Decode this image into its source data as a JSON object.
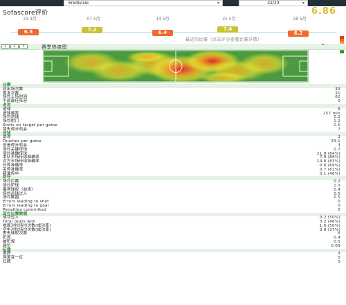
{
  "header": {
    "league": "Eredivisie",
    "season": "22/23",
    "rating_title": "Sofascore评价",
    "average_rating": "6.86"
  },
  "timeline": {
    "dates": [
      "23 4月",
      "07 5月",
      "14 5月",
      "21 5月",
      "28 5月"
    ],
    "ratings": [
      {
        "value": "6.5",
        "color": "#f06a2c"
      },
      {
        "value": "7.2",
        "color": "#c8c431"
      },
      {
        "value": "6.4",
        "color": "#f06a2c"
      },
      {
        "value": "7.4",
        "color": "#c8c431"
      },
      {
        "value": "6.2",
        "color": "#f06a2c"
      }
    ],
    "caption": "最近的比赛（点击评分查看比赛详情）",
    "scale_colors": [
      "#2a8f3c",
      "#6fbf3a",
      "#c8c431",
      "#f3a52c",
      "#f06a2c",
      "#e8352b"
    ]
  },
  "heatmap": {
    "tabs": [
      "1",
      "2",
      "3"
    ],
    "title": "赛季热度图"
  },
  "stats": [
    {
      "label": "比赛",
      "value": "",
      "section": true
    },
    {
      "label": "总出场次数",
      "value": "33"
    },
    {
      "label": "首发次数",
      "value": "31"
    },
    {
      "label": "场均上场时间",
      "value": "62"
    },
    {
      "label": "平局最佳阵容",
      "value": "0"
    },
    {
      "label": "进攻",
      "value": "",
      "section": true
    },
    {
      "label": "进球",
      "value": "8"
    },
    {
      "label": "进球频率",
      "value": "257 min"
    },
    {
      "label": "场均进球",
      "value": "0.2"
    },
    {
      "label": "场均射门",
      "value": "1.2"
    },
    {
      "label": "Shots on target per game",
      "value": "0.5"
    },
    {
      "label": "错失得分机会",
      "value": "7"
    },
    {
      "label": "传球",
      "value": "",
      "section": true
    },
    {
      "label": "助攻",
      "value": "3"
    },
    {
      "label": "Touches per game",
      "value": "33.1"
    },
    {
      "label": "创造得分机会",
      "value": "3"
    },
    {
      "label": "场均关键传球",
      "value": "0.7"
    },
    {
      "label": "场均准确传球",
      "value": "21.8 (84%)"
    },
    {
      "label": "本队半场传球准确率",
      "value": "7.0 (86%)"
    },
    {
      "label": "对方半场传球准确率",
      "value": "14.8 (83%)"
    },
    {
      "label": "长传准确率",
      "value": "0.6 (69%)"
    },
    {
      "label": "吊传准确率",
      "value": "0.7 (61%)"
    },
    {
      "label": "精准传中",
      "value": "0.1 (46%)"
    },
    {
      "label": "防守",
      "value": "",
      "section": true
    },
    {
      "label": "场均拦截",
      "value": "0.2"
    },
    {
      "label": "场均铲球",
      "value": "1.0"
    },
    {
      "label": "赢得球权（前场）",
      "value": "0.4"
    },
    {
      "label": "场均运球过人",
      "value": "0.5"
    },
    {
      "label": "场均解围",
      "value": "0.5"
    },
    {
      "label": "Errors leading to shot",
      "value": "0"
    },
    {
      "label": "Errors leading to goal",
      "value": "0"
    },
    {
      "label": "Penalties committed",
      "value": "0"
    },
    {
      "label": "其它比赛数据",
      "value": "",
      "section": true
    },
    {
      "label": "成功过人",
      "value": "0.2 (50%)"
    },
    {
      "label": "Total duels won",
      "value": "3.2 (46%)"
    },
    {
      "label": "地面对抗场均次数(成功率)",
      "value": "1.6 (50%)"
    },
    {
      "label": "空中对抗场均次数(成功率)",
      "value": "0.8 (37%)"
    },
    {
      "label": "丢失球权次数",
      "value": "6"
    },
    {
      "label": "犯规",
      "value": "0.4"
    },
    {
      "label": "被犯规",
      "value": "0.5"
    },
    {
      "label": "越位",
      "value": "0.09"
    },
    {
      "label": "纪律",
      "value": "",
      "section": true
    },
    {
      "label": "黄牌",
      "value": "3"
    },
    {
      "label": "两黄变一红",
      "value": "0"
    },
    {
      "label": "红牌",
      "value": "0"
    }
  ]
}
